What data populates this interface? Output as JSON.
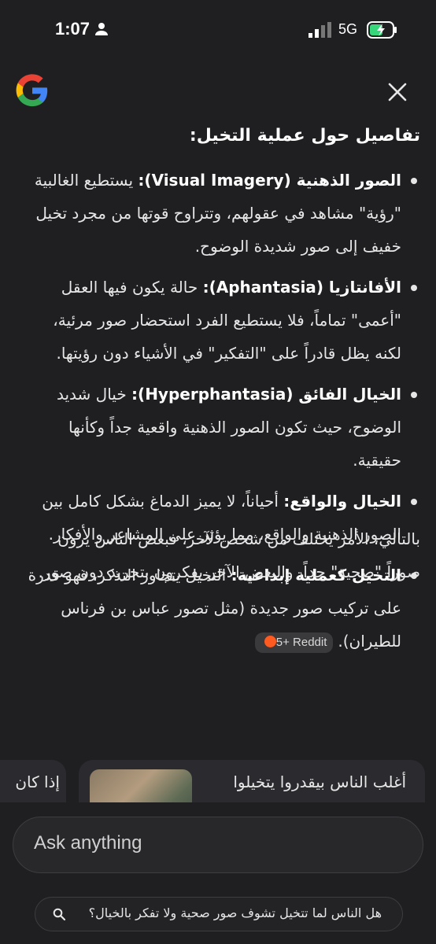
{
  "status": {
    "time": "1:07",
    "network": "5G"
  },
  "header": {
    "logo": "google-logo",
    "close_icon": "close-icon"
  },
  "overview": {
    "heading": "تفاصيل حول عملية التخيل:",
    "items": [
      {
        "term": "الصور الذهنية (Visual Imagery):",
        "text": " يستطيع الغالبية \"رؤية\" مشاهد في عقولهم، وتتراوح قوتها من مجرد تخيل خفيف إلى صور شديدة الوضوح."
      },
      {
        "term": "الأفانتازيا (Aphantasia):",
        "text": " حالة يكون فيها العقل \"أعمى\" تماماً، فلا يستطيع الفرد استحضار صور مرئية، لكنه يظل قادراً على \"التفكير\" في الأشياء دون رؤيتها."
      },
      {
        "term": "الخيال الفائق (Hyperphantasia):",
        "text": " خيال شديد الوضوح، حيث تكون الصور الذهنية واقعية جداً وكأنها حقيقية."
      },
      {
        "term": "الخيال والواقع:",
        "text": " أحياناً، لا يميز الدماغ بشكل كامل بين الصور الذهنية والواقع، مما يؤثر على المشاعر والأفكار."
      },
      {
        "term": "التخيل كعملية إبداعية:",
        "text": " التخيل يتجاوز التذكر، فهو قدرة على تركيب صور جديدة (مثل تصور عباس بن فرناس للطيران)."
      }
    ],
    "source_chip": "5+ Reddit",
    "summary": "بالتالي، الأمر يختلف من شخص لآخر، فبعض الناس يرون صوراً \"صحية\" جداً، والبعض الآخر يفكرون بتجريد دون صور."
  },
  "cards": [
    {
      "text": "أغلب الناس بيقدروا يتخيلوا"
    },
    {
      "text": "إذا كان"
    }
  ],
  "input": {
    "placeholder": "Ask anything"
  },
  "suggestion": {
    "text": "هل الناس لما تتخيل تشوف صور صحية ولا تفكر بالخيال؟"
  }
}
